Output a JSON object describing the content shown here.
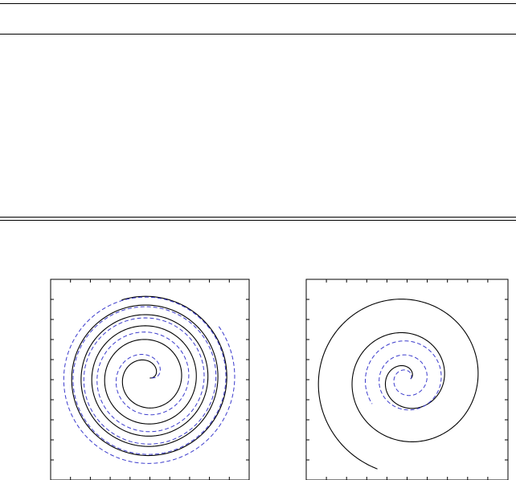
{
  "colors": {
    "solid": "#000000",
    "dashed": "#3a3acc"
  },
  "figure": {
    "panels": [
      {
        "name": "left-spiral-panel",
        "curves": [
          {
            "style": "solid",
            "turns": 5.3,
            "r_start": 0.03,
            "r_end": 0.93,
            "growth": 0.55
          },
          {
            "style": "dashed",
            "turns": 5.1,
            "r_start": 0.05,
            "r_end": 1.0,
            "growth": 0.5
          }
        ]
      },
      {
        "name": "right-spiral-panel",
        "curves": [
          {
            "style": "solid",
            "turns": 2.7,
            "r_start": 0.04,
            "r_end": 1.0,
            "growth": 1.0
          },
          {
            "style": "dashed",
            "turns": 2.6,
            "r_start": 0.04,
            "r_end": 0.45,
            "growth": 0.9
          }
        ]
      }
    ]
  }
}
